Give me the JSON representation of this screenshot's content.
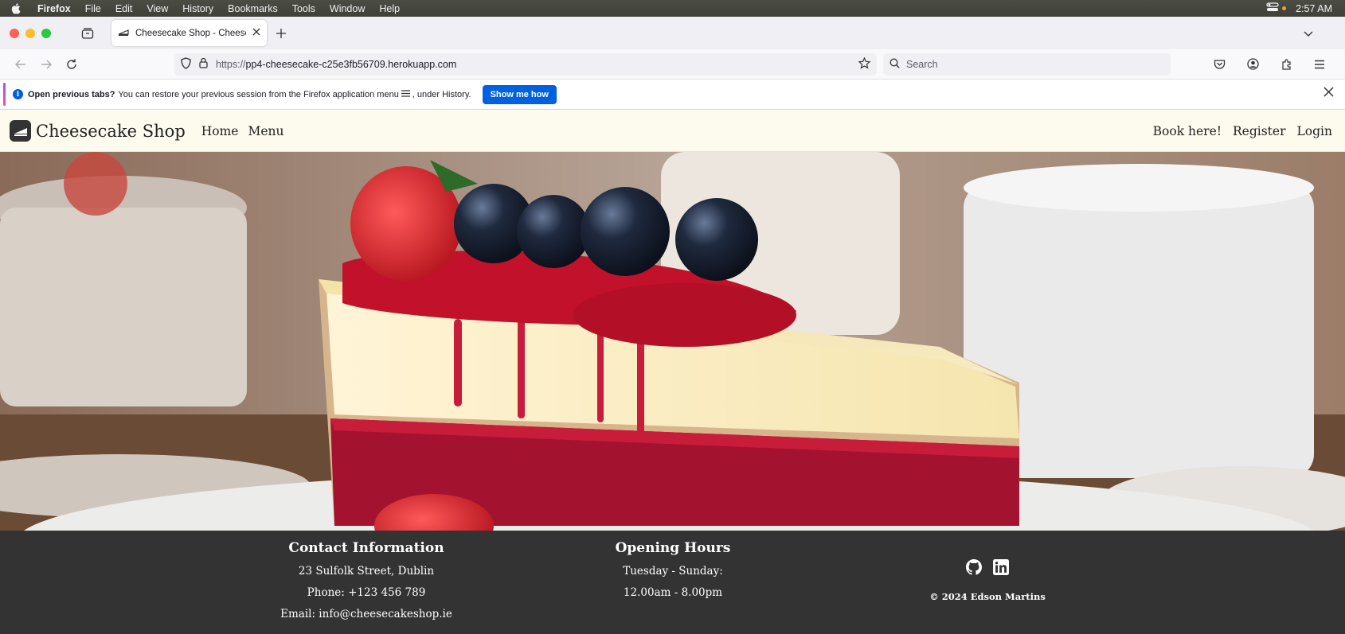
{
  "menubar": {
    "app_name": "Firefox",
    "items": [
      "File",
      "Edit",
      "View",
      "History",
      "Bookmarks",
      "Tools",
      "Window",
      "Help"
    ],
    "clock": "2:57 AM"
  },
  "browser": {
    "tab_title": "Cheesecake Shop - Cheesecake",
    "url_scheme": "https://",
    "url_host": "pp4-cheesecake-c25e3fb56709.herokuapp.com",
    "search_placeholder": "Search"
  },
  "notification": {
    "bold": "Open previous tabs?",
    "text_before_icon": "You can restore your previous session from the Firefox application menu",
    "text_after_icon": ", under History.",
    "button": "Show me how"
  },
  "site": {
    "brand": "Cheesecake Shop",
    "nav_left": [
      "Home",
      "Menu"
    ],
    "nav_right": [
      "Book here!",
      "Register",
      "Login"
    ],
    "footer": {
      "contact_title": "Contact Information",
      "address": "23 Sulfolk Street, Dublin",
      "phone": "Phone: +123 456 789",
      "email": "Email: info@cheesecakeshop.ie",
      "hours_title": "Opening Hours",
      "days": "Tuesday - Sunday:",
      "times": "12.00am - 8.00pm",
      "copyright": "© 2024 Edson Martins",
      "social": [
        "github-icon",
        "linkedin-icon"
      ]
    }
  }
}
